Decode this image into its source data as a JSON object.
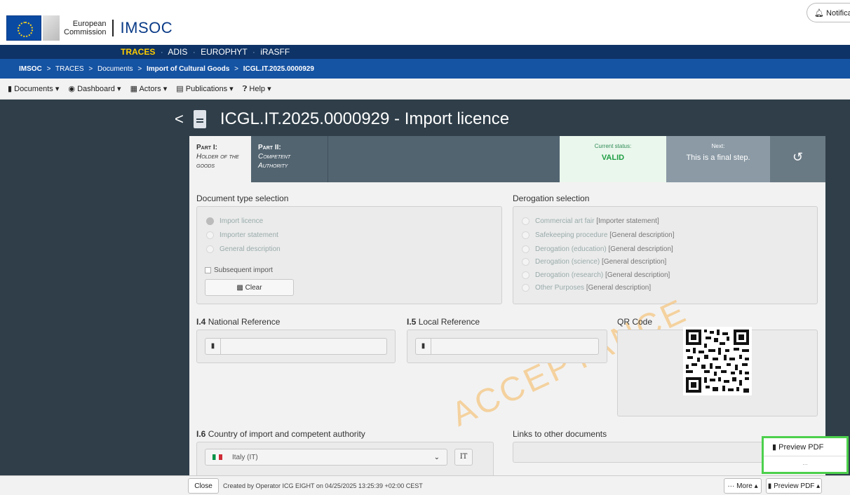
{
  "header": {
    "logo_line1": "European",
    "logo_line2": "Commission",
    "app_title": "IMSOC",
    "notifications": "Notifica"
  },
  "nav": {
    "items": [
      "TRACES",
      "ADIS",
      "EUROPHYT",
      "iRASFF"
    ],
    "separator": "·"
  },
  "breadcrumb": [
    "IMSOC",
    "TRACES",
    "Documents",
    "Import of Cultural Goods",
    "ICGL.IT.2025.0000929"
  ],
  "menu": [
    "Documents",
    "Dashboard",
    "Actors",
    "Publications",
    "Help"
  ],
  "doc_title": "ICGL.IT.2025.0000929 - Import licence",
  "tabs": [
    {
      "title": "Part I:",
      "desc1": "Holder of the",
      "desc2": "goods"
    },
    {
      "title": "Part II:",
      "desc1": "Competent",
      "desc2": "Authority"
    }
  ],
  "status": {
    "label": "Current status:",
    "value": "VALID"
  },
  "next": {
    "label": "Next:",
    "value": "This is a final step."
  },
  "history_icon": "history-icon",
  "doc_type": {
    "label": "Document type selection",
    "options": [
      "Import licence",
      "Importer statement",
      "General description"
    ],
    "selected": "Import licence",
    "subsequent_import": "Subsequent import",
    "clear": "Clear"
  },
  "derogation": {
    "label": "Derogation selection",
    "options": [
      {
        "name": "Commercial art fair",
        "extra": "[Importer statement]"
      },
      {
        "name": "Safekeeping procedure",
        "extra": "[General description]"
      },
      {
        "name": "Derogation (education)",
        "extra": "[General description]"
      },
      {
        "name": "Derogation (science)",
        "extra": "[General description]"
      },
      {
        "name": "Derogation (research)",
        "extra": "[General description]"
      },
      {
        "name": "Other Purposes",
        "extra": "[General description]"
      }
    ]
  },
  "national_ref": {
    "num": "I.4",
    "label": "National Reference"
  },
  "local_ref": {
    "num": "I.5",
    "label": "Local Reference"
  },
  "qr": {
    "label": "QR Code"
  },
  "watermark": "ACCEPTANCE",
  "country": {
    "num": "I.6",
    "label": "Country of import and competent authority",
    "value": "Italy (IT)",
    "code": "IT"
  },
  "links": {
    "label": "Links to other documents"
  },
  "popup": {
    "item": "Preview PDF",
    "more": "..."
  },
  "footer": {
    "close": "Close",
    "created": "Created by Operator ICG EIGHT on 04/25/2025 13:25:39 +02:00 CEST",
    "more": "··· More ▴",
    "preview": "Preview PDF ▴"
  },
  "colors": {
    "navy": "#0e3366",
    "blue": "#1553a3",
    "dark": "#2f3e49",
    "valid": "#1e9e44",
    "highlight": "#4cd04c"
  }
}
